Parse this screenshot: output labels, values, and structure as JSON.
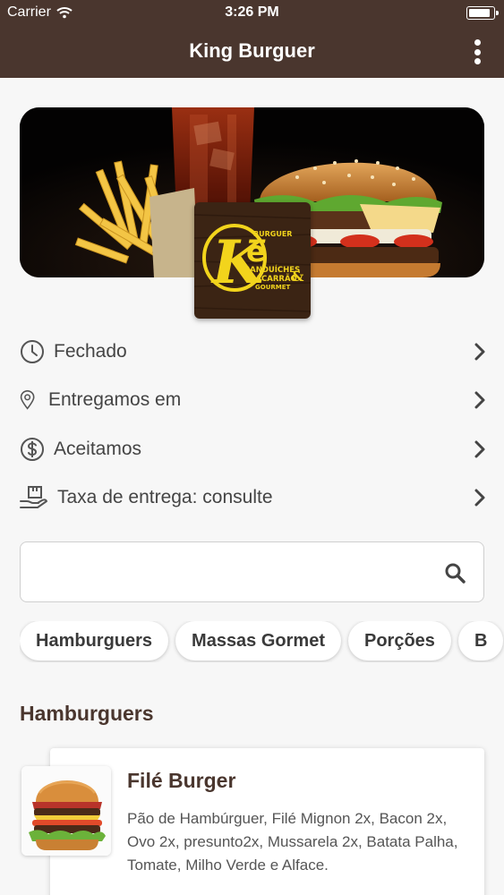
{
  "status_bar": {
    "carrier": "Carrier",
    "time": "3:26 PM",
    "battery_level": 0.9
  },
  "header": {
    "title": "King Burguer",
    "menu_icon": "more-vertical-icon"
  },
  "banner": {
    "logo_text": [
      "BURGUER",
      "SANDUÍCHES",
      "MACARRÃO",
      "GOURMET"
    ]
  },
  "info": [
    {
      "icon": "clock-icon",
      "label": "Fechado"
    },
    {
      "icon": "location-pin-icon",
      "label": "Entregamos em"
    },
    {
      "icon": "dollar-icon",
      "label": "Aceitamos"
    },
    {
      "icon": "delivery-box-icon",
      "label": "Taxa de entrega: consulte"
    }
  ],
  "search": {
    "value": "",
    "placeholder": ""
  },
  "categories": [
    "Hamburguers",
    "Massas Gormet",
    "Porções",
    "B"
  ],
  "section": {
    "title": "Hamburguers"
  },
  "products": [
    {
      "name": "Filé Burger",
      "description": "Pão de Hambúrguer, Filé Mignon 2x, Bacon 2x, Ovo 2x, presunto2x, Mussarela 2x, Batata Palha, Tomate, Milho Verde e Alface."
    }
  ],
  "colors": {
    "brand": "#4a362e",
    "accent_yellow": "#f2d41c",
    "background": "#f7f7f7"
  }
}
